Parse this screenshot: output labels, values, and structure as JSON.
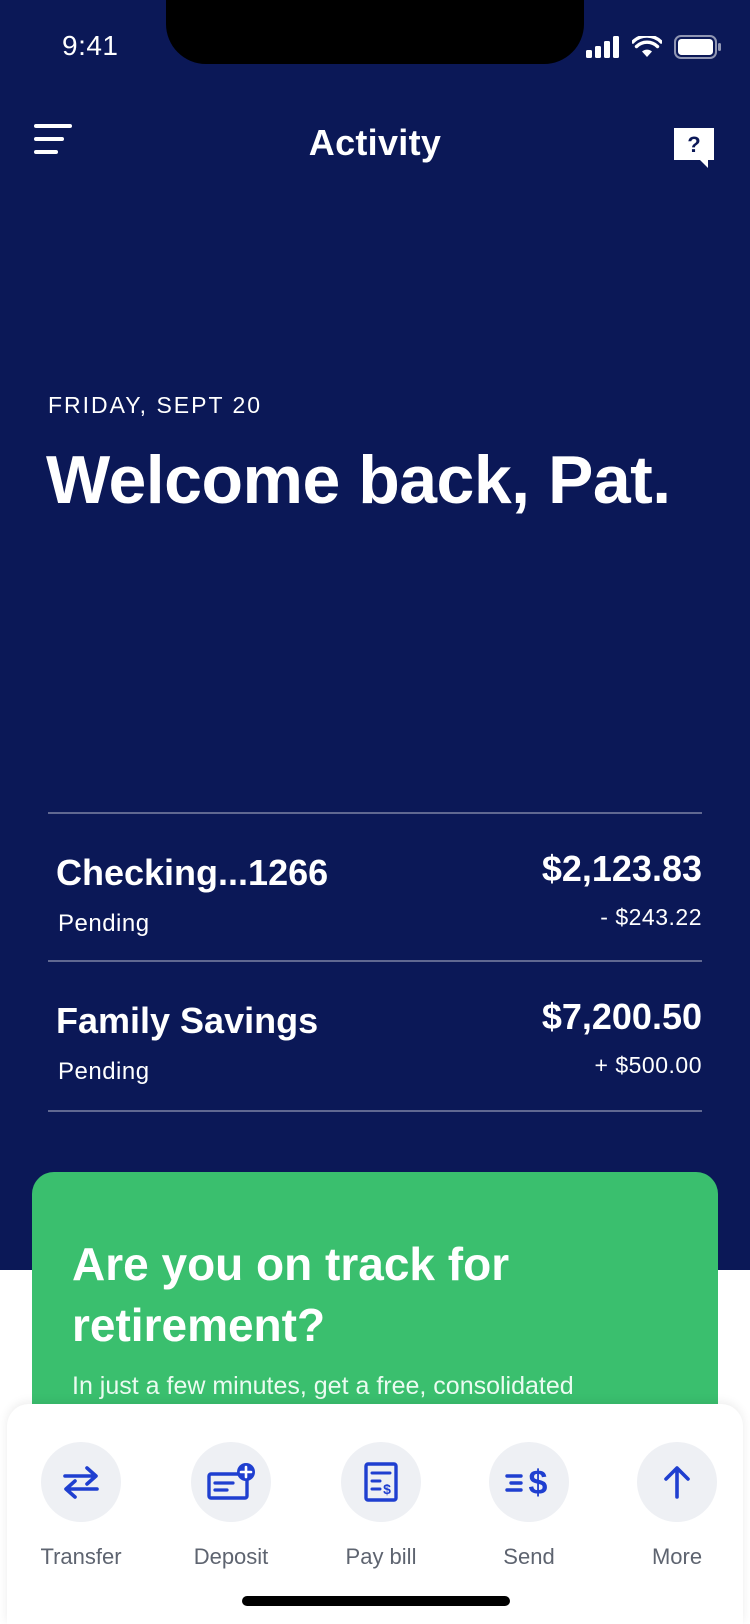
{
  "status_bar": {
    "time": "9:41",
    "icons": [
      "signal-icon",
      "wifi-icon",
      "battery-icon"
    ]
  },
  "nav": {
    "title": "Activity",
    "menu_icon": "hamburger-menu-icon",
    "help_icon": "help-chat-icon"
  },
  "greeting": {
    "date": "FRIDAY, SEPT 20",
    "welcome": "Welcome back, Pat."
  },
  "accounts": [
    {
      "name": "Checking...1266",
      "status": "Pending",
      "balance": "$2,123.83",
      "pending_amount": "- $243.22"
    },
    {
      "name": "Family Savings",
      "status": "Pending",
      "balance": "$7,200.50",
      "pending_amount": "+ $500.00"
    }
  ],
  "promo": {
    "title": "Are you on track for retirement?",
    "body": "In just a few minutes, get a free, consolidated"
  },
  "actions": [
    {
      "label": "Transfer",
      "icon": "transfer-arrows-icon"
    },
    {
      "label": "Deposit",
      "icon": "deposit-check-icon"
    },
    {
      "label": "Pay bill",
      "icon": "bill-icon"
    },
    {
      "label": "Send",
      "icon": "send-money-icon"
    },
    {
      "label": "More",
      "icon": "arrow-up-icon"
    }
  ],
  "colors": {
    "navy": "#0b1857",
    "green": "#3abf6e",
    "accent_blue": "#1f3fd0"
  }
}
